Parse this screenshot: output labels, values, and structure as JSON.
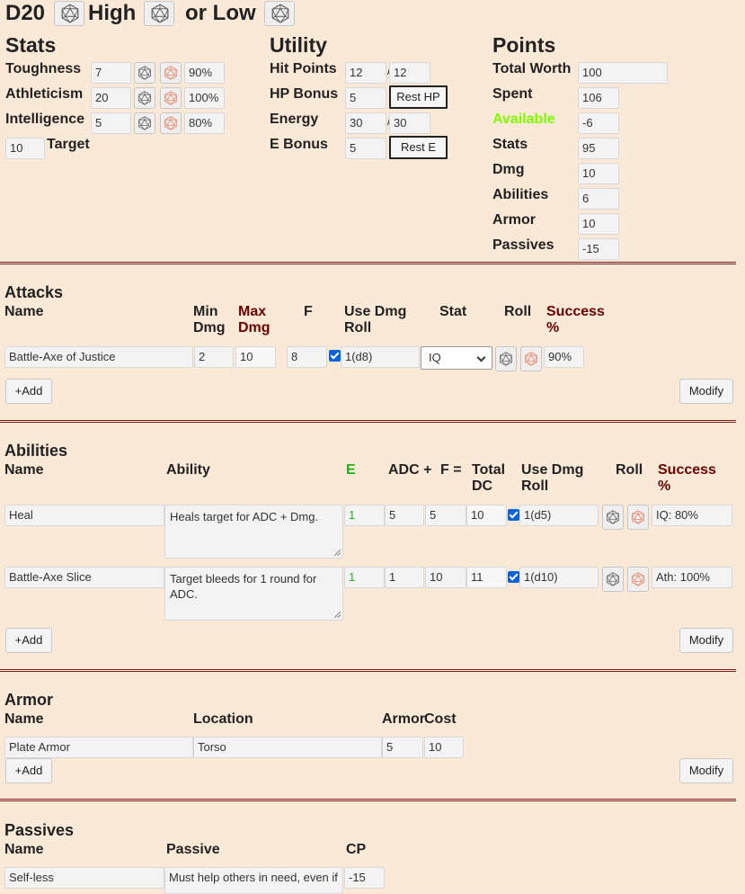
{
  "header": {
    "title": "D20",
    "high": "High",
    "or_low": "or Low"
  },
  "stats": {
    "heading": "Stats",
    "rows": [
      {
        "label": "Toughness",
        "value": "7",
        "pct": "90%"
      },
      {
        "label": "Athleticism",
        "value": "20",
        "pct": "100%"
      },
      {
        "label": "Intelligence",
        "value": "5",
        "pct": "80%"
      }
    ],
    "target_value": "10",
    "target_label": "Target"
  },
  "utility": {
    "heading": "Utility",
    "hit_points_label": "Hit Points",
    "hp_current": "12",
    "hp_max": "12",
    "hp_bonus_label": "HP Bonus",
    "hp_bonus": "5",
    "rest_hp": "Rest HP",
    "energy_label": "Energy",
    "e_current": "30",
    "e_max": "30",
    "e_bonus_label": "E Bonus",
    "e_bonus": "5",
    "rest_e": "Rest E",
    "slash": "/"
  },
  "points": {
    "heading": "Points",
    "rows": [
      {
        "label": "Total Worth",
        "value": "100"
      },
      {
        "label": "Spent",
        "value": "106"
      },
      {
        "label": "Available",
        "value": "-6"
      },
      {
        "label": "Stats",
        "value": "95"
      },
      {
        "label": "Dmg",
        "value": "10"
      },
      {
        "label": "Abilities",
        "value": "6"
      },
      {
        "label": "Armor",
        "value": "10"
      },
      {
        "label": "Passives",
        "value": "-15"
      }
    ]
  },
  "attacks": {
    "heading": "Attacks",
    "cols": {
      "name": "Name",
      "min": "Min Dmg",
      "min1": "Min",
      "min2": "Dmg",
      "max1": "Max",
      "max2": "Dmg",
      "f": "F",
      "use1": "Use Dmg",
      "use2": "Roll",
      "stat": "Stat",
      "roll": "Roll",
      "succ1": "Success",
      "succ2": "%"
    },
    "rows": [
      {
        "name": "Battle-Axe of Justice",
        "min": "2",
        "max": "10",
        "f": "8",
        "roll": "1(d8)",
        "stat": "IQ",
        "success": "90%"
      }
    ],
    "add": "+Add",
    "modify": "Modify"
  },
  "abilities": {
    "heading": "Abilities",
    "cols": {
      "name": "Name",
      "ability": "Ability",
      "e": "E",
      "adc": "ADC +",
      "f": "F =",
      "total1": "Total",
      "total2": "DC",
      "use1": "Use Dmg",
      "use2": "Roll",
      "roll": "Roll",
      "succ1": "Success",
      "succ2": "%"
    },
    "rows": [
      {
        "name": "Heal",
        "desc": "Heals target for ADC + Dmg.",
        "e": "1",
        "adc": "5",
        "f": "5",
        "total": "10",
        "roll": "1(d5)",
        "success": "IQ: 80%"
      },
      {
        "name": "Battle-Axe Slice",
        "desc": "Target bleeds for 1 round for ADC.",
        "e": "1",
        "adc": "1",
        "f": "10",
        "total": "11",
        "roll": "1(d10)",
        "success": "Ath: 100%"
      }
    ],
    "add": "+Add",
    "modify": "Modify"
  },
  "armor": {
    "heading": "Armor",
    "cols": {
      "name": "Name",
      "location": "Location",
      "armor": "Armor",
      "cost": "Cost"
    },
    "rows": [
      {
        "name": "Plate Armor",
        "location": "Torso",
        "armor": "5",
        "cost": "10"
      }
    ],
    "add": "+Add",
    "modify": "Modify"
  },
  "passives": {
    "heading": "Passives",
    "cols": {
      "name": "Name",
      "passive": "Passive",
      "cp": "CP"
    },
    "rows": [
      {
        "name": "Self-less",
        "desc": "Must help others in need, even if",
        "cp": "-15"
      }
    ]
  },
  "colors": {
    "background": "#fbe9d7",
    "available": "#7cfc00",
    "energy": "#22b022",
    "success": "#6b0000",
    "divider": "#7a1e1e",
    "checkbox": "#0a63d8"
  }
}
